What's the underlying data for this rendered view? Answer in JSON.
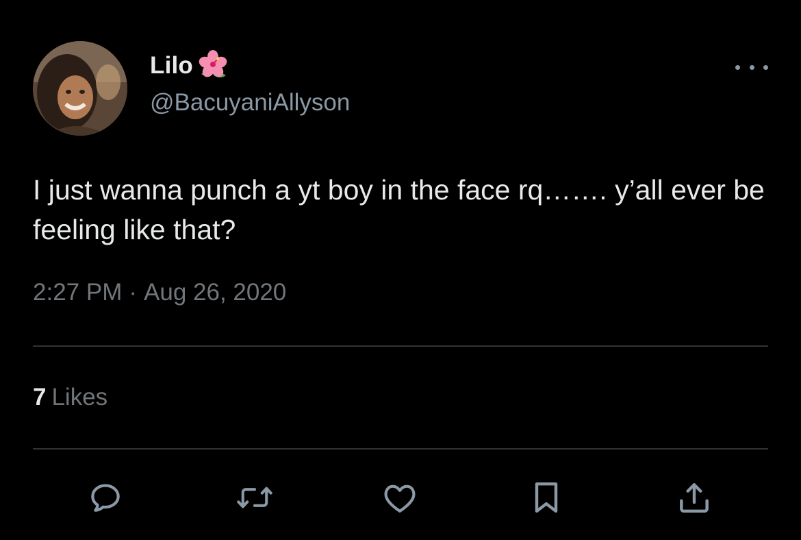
{
  "author": {
    "display_name": "Lilo",
    "name_emoji": "hibiscus-flower-icon",
    "handle": "@BacuyaniAllyson"
  },
  "tweet": {
    "text": "I just wanna punch a yt boy in the face rq……. y’all ever be feeling like that?",
    "time": "2:27 PM",
    "separator": "·",
    "date": "Aug 26, 2020"
  },
  "stats": {
    "likes_count": "7",
    "likes_label": "Likes"
  },
  "actions": [
    "reply-icon",
    "retweet-icon",
    "like-icon",
    "bookmark-icon",
    "share-icon"
  ],
  "colors": {
    "background": "#000000",
    "primary_text": "#e7e9ea",
    "secondary_text": "#71767b",
    "icon": "#8b98a5",
    "divider": "#2f3336"
  }
}
